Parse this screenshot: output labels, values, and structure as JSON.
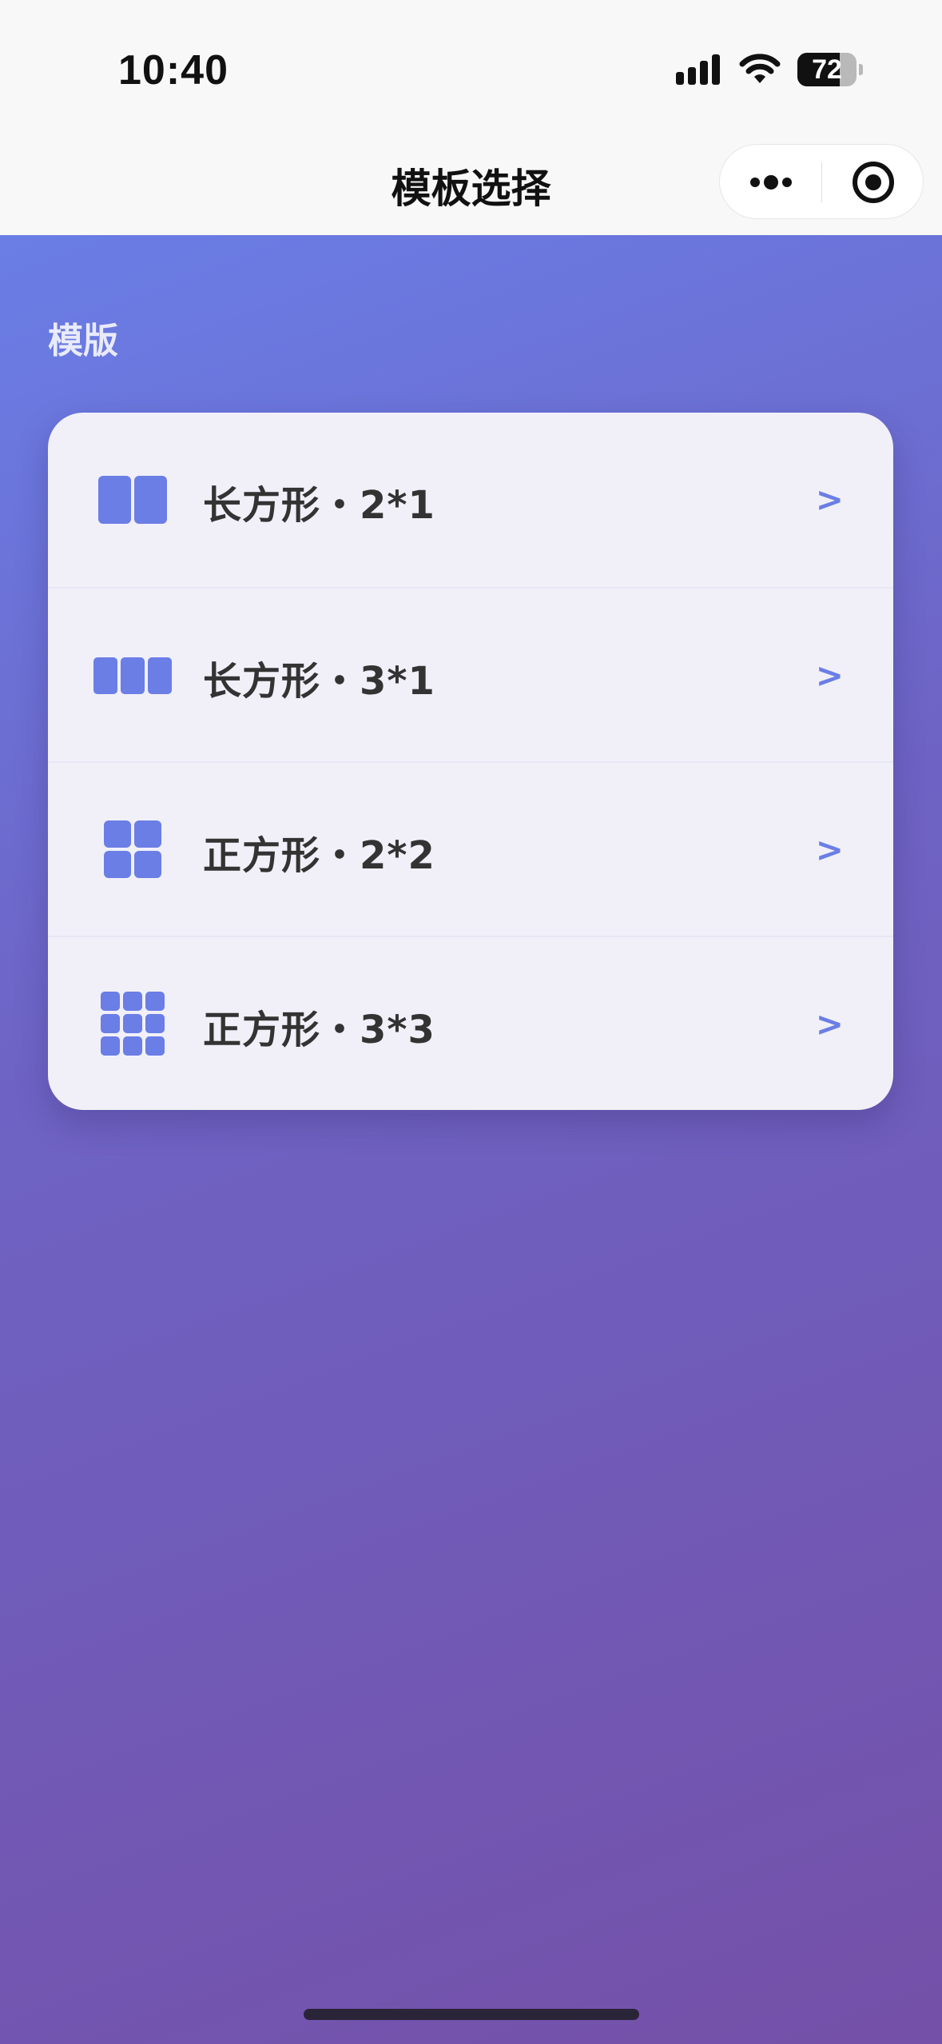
{
  "status_bar": {
    "time": "10:40",
    "battery_level": "72",
    "battery_fraction": 0.72
  },
  "nav": {
    "title": "模板选择"
  },
  "section": {
    "title": "模版"
  },
  "templates": [
    {
      "label": "长方形・2*1",
      "icon": "grid-2x1-icon",
      "arrow": ">"
    },
    {
      "label": "长方形・3*1",
      "icon": "grid-3x1-icon",
      "arrow": ">"
    },
    {
      "label": "正方形・2*2",
      "icon": "grid-2x2-icon",
      "arrow": ">"
    },
    {
      "label": "正方形・3*3",
      "icon": "grid-3x3-icon",
      "arrow": ">"
    }
  ],
  "colors": {
    "accent": "#6a7ee6",
    "gradient_start": "#6a7ee6",
    "gradient_end": "#7450a8",
    "card_bg": "#f1f0f9",
    "label_text": "#333333"
  }
}
